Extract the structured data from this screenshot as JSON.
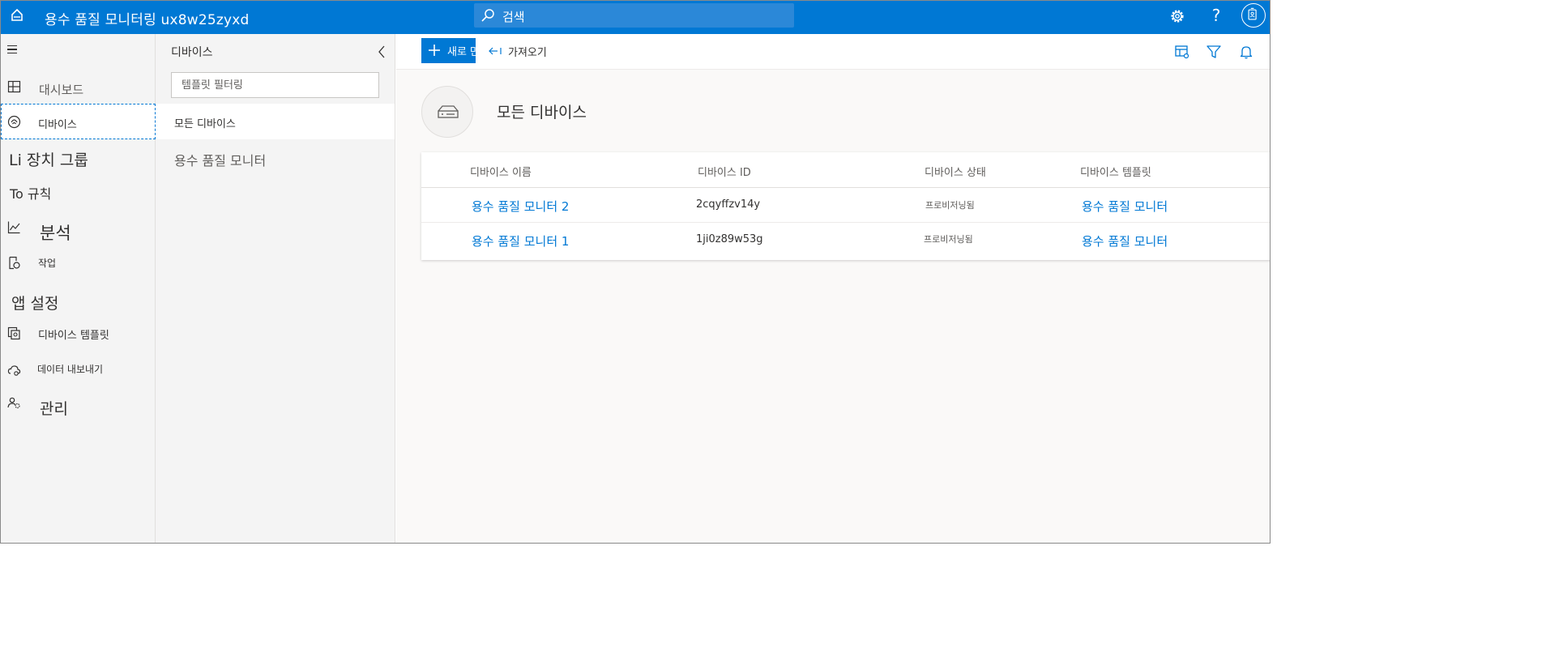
{
  "topbar": {
    "app_title": "용수 품질 모니터링 ux8w25zyxd",
    "search_placeholder": "검색",
    "icons": [
      "app-logo-icon",
      "search-icon",
      "gear-icon",
      "help-icon",
      "avatar-icon"
    ],
    "help_glyph": "?"
  },
  "leftnav": {
    "items": [
      {
        "label": "대시보드",
        "icon": "dashboard-icon"
      },
      {
        "label": "디바이스",
        "icon": "devices-icon",
        "selected": true
      },
      {
        "label": "Li 장치 그룹"
      },
      {
        "label": "To 규칙"
      },
      {
        "label": "분석",
        "icon": "analytics-icon"
      },
      {
        "label": "작업",
        "icon": "jobs-icon"
      },
      {
        "label": "앱 설정"
      },
      {
        "label": "디바이스 템플릿",
        "icon": "device-templates-icon"
      },
      {
        "label": "데이터 내보내기",
        "icon": "data-export-icon"
      },
      {
        "label": "관리",
        "icon": "administration-icon"
      }
    ]
  },
  "midpanel": {
    "title": "디바이스",
    "filter_placeholder": "템플릿 필터링",
    "items": [
      {
        "label": "모든 디바이스",
        "selected": true
      },
      {
        "label": "용수 품질 모니터"
      }
    ]
  },
  "cmdbar": {
    "new_label": "새로 만들기",
    "import_label": "가져오기",
    "right_icons": [
      "edit-columns-icon",
      "filter-icon",
      "notification-bell-icon"
    ]
  },
  "content": {
    "title": "모든 디바이스",
    "table": {
      "columns": [
        "디바이스 이름",
        "디바이스 ID",
        "디바이스 상태",
        "디바이스 템플릿"
      ],
      "rows": [
        {
          "name": "용수 품질 모니터 2",
          "id": "2cqyffzv14y",
          "status": "프로비저닝됨",
          "template": "용수 품질 모니터"
        },
        {
          "name": "용수 품질 모니터 1",
          "id": "1ji0z89w53g",
          "status": "프로비저닝됨",
          "template": "용수 품질 모니터"
        }
      ]
    }
  },
  "colors": {
    "accent": "#0078d4",
    "nav_bg": "#f4f4f4",
    "content_bg": "#faf9f8"
  }
}
